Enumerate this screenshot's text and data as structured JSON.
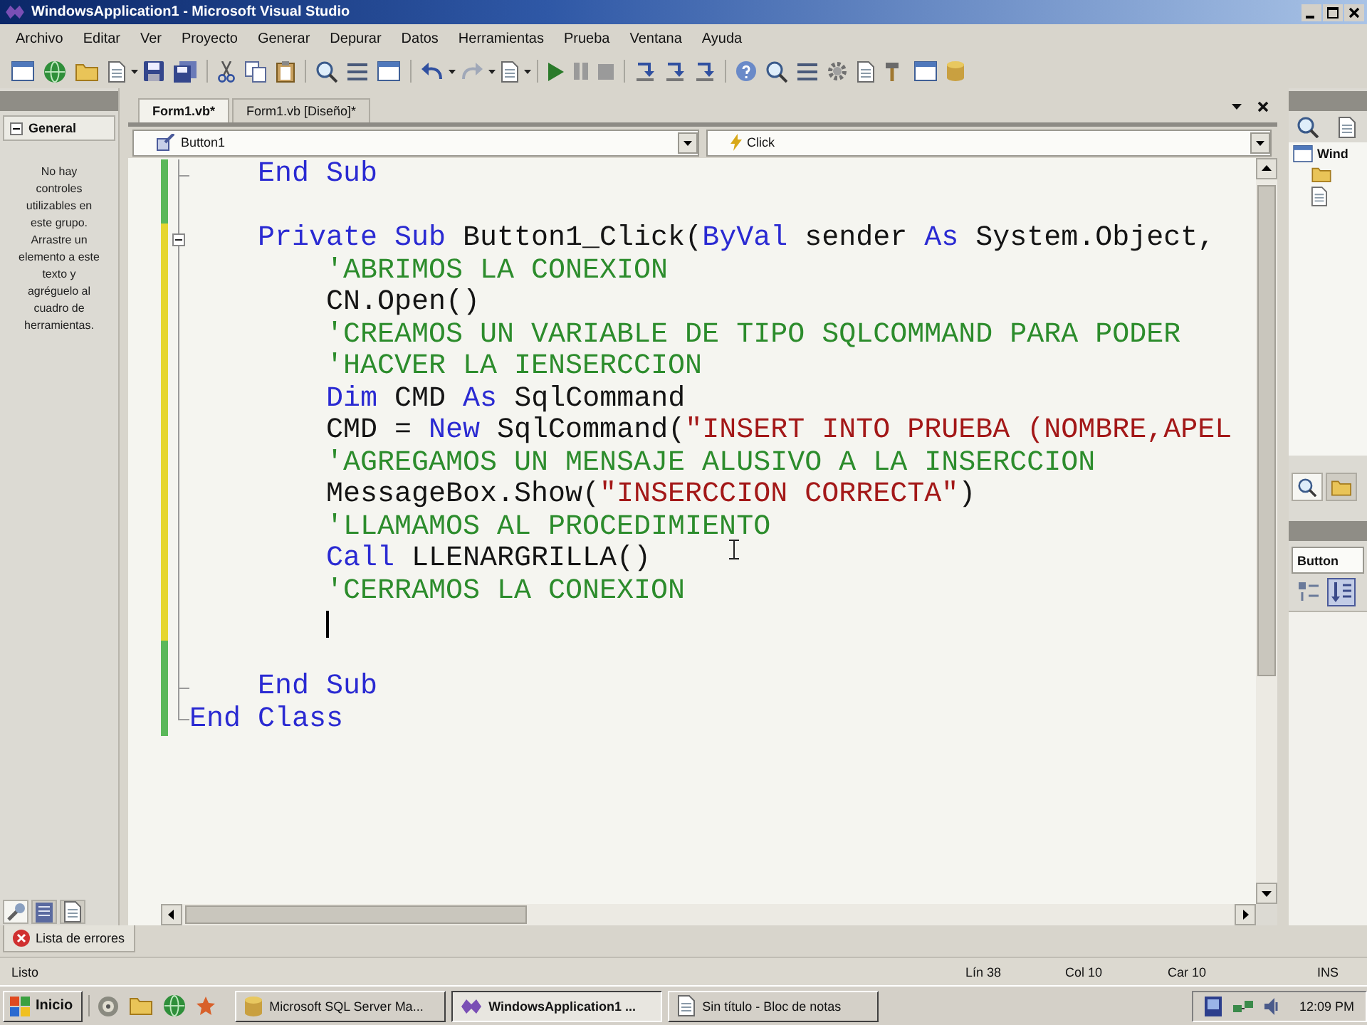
{
  "window": {
    "title": "WindowsApplication1 - Microsoft Visual Studio"
  },
  "menu": [
    "Archivo",
    "Editar",
    "Ver",
    "Proyecto",
    "Generar",
    "Depurar",
    "Datos",
    "Herramientas",
    "Prueba",
    "Ventana",
    "Ayuda"
  ],
  "toolbox": {
    "group": "General",
    "expanded": true,
    "message": "No hay controles utilizables en este grupo. Arrastre un elemento a este texto y agréguelo al cuadro de herramientas."
  },
  "side_tabs": [
    {
      "selected": true
    },
    {
      "selected": false
    },
    {
      "selected": false
    }
  ],
  "doc_tabs": [
    {
      "label": "Form1.vb*",
      "selected": true
    },
    {
      "label": "Form1.vb [Diseño]*",
      "selected": false
    }
  ],
  "editor": {
    "object_combo": "Button1",
    "event_combo": "Click",
    "lines": [
      {
        "kind": "end",
        "saved": true,
        "tokens": [
          {
            "kind": "keyword",
            "text": "    End Sub"
          }
        ]
      },
      {
        "kind": "blank",
        "saved": true
      },
      {
        "kind": "fold",
        "saved": false,
        "tokens": [
          {
            "kind": "keyword",
            "text": "    Private Sub"
          },
          {
            "kind": "plain",
            "text": " Button1_Click("
          },
          {
            "kind": "keyword",
            "text": "ByVal"
          },
          {
            "kind": "plain",
            "text": " sender "
          },
          {
            "kind": "keyword",
            "text": "As"
          },
          {
            "kind": "plain",
            "text": " System.Object,"
          }
        ]
      },
      {
        "kind": "code",
        "saved": false,
        "tokens": [
          {
            "kind": "comment",
            "text": "        'ABRIMOS LA CONEXION"
          }
        ]
      },
      {
        "kind": "code",
        "saved": false,
        "tokens": [
          {
            "kind": "plain",
            "text": "        CN.Open()"
          }
        ]
      },
      {
        "kind": "code",
        "saved": false,
        "tokens": [
          {
            "kind": "comment",
            "text": "        'CREAMOS UN VARIABLE DE TIPO SQLCOMMAND PARA PODER"
          }
        ]
      },
      {
        "kind": "code",
        "saved": false,
        "tokens": [
          {
            "kind": "comment",
            "text": "        'HACVER LA IENSERCCION"
          }
        ]
      },
      {
        "kind": "code",
        "saved": false,
        "tokens": [
          {
            "kind": "keyword",
            "text": "        Dim"
          },
          {
            "kind": "plain",
            "text": " CMD "
          },
          {
            "kind": "keyword",
            "text": "As"
          },
          {
            "kind": "plain",
            "text": " SqlCommand"
          }
        ]
      },
      {
        "kind": "code",
        "saved": false,
        "tokens": [
          {
            "kind": "plain",
            "text": "        CMD = "
          },
          {
            "kind": "keyword",
            "text": "New"
          },
          {
            "kind": "plain",
            "text": " SqlCommand("
          },
          {
            "kind": "string",
            "text": "\"INSERT INTO PRUEBA (NOMBRE,APEL"
          }
        ]
      },
      {
        "kind": "code",
        "saved": false,
        "tokens": [
          {
            "kind": "comment",
            "text": "        'AGREGAMOS UN MENSAJE ALUSIVO A LA INSERCCION"
          }
        ]
      },
      {
        "kind": "code",
        "saved": false,
        "tokens": [
          {
            "kind": "plain",
            "text": "        MessageBox.Show("
          },
          {
            "kind": "string",
            "text": "\"INSERCCION CORRECTA\""
          },
          {
            "kind": "plain",
            "text": ")"
          }
        ]
      },
      {
        "kind": "code",
        "saved": false,
        "tokens": [
          {
            "kind": "comment",
            "text": "        'LLAMAMOS AL PROCEDIMIENTO"
          }
        ]
      },
      {
        "kind": "code",
        "saved": false,
        "tokens": [
          {
            "kind": "keyword",
            "text": "        Call"
          },
          {
            "kind": "plain",
            "text": " LLENARGRILLA()"
          }
        ]
      },
      {
        "kind": "code",
        "saved": false,
        "tokens": [
          {
            "kind": "comment",
            "text": "        'CERRAMOS LA CONEXION"
          }
        ]
      },
      {
        "kind": "caret",
        "saved": false
      },
      {
        "kind": "blank",
        "saved": true
      },
      {
        "kind": "end",
        "saved": true,
        "tokens": [
          {
            "kind": "keyword",
            "text": "    End Sub"
          }
        ]
      },
      {
        "kind": "end",
        "saved": true,
        "tokens": [
          {
            "kind": "keyword",
            "text": "End Class"
          }
        ]
      }
    ]
  },
  "solution_explorer": {
    "items": [
      {
        "label": "Wind"
      }
    ],
    "tabs": [
      {
        "selected": true
      },
      {
        "selected": false
      }
    ]
  },
  "properties": {
    "object": "Button",
    "views": [
      {
        "selected": false
      },
      {
        "selected": true
      }
    ]
  },
  "error_list_tab": "Lista de errores",
  "status_bar": {
    "message": "Listo",
    "line": "Lín 38",
    "col": "Col 10",
    "char": "Car 10",
    "mode": "INS"
  },
  "taskbar": {
    "start": "Inicio",
    "tasks": [
      {
        "label": "Microsoft SQL Server Ma...",
        "selected": false
      },
      {
        "label": "WindowsApplication1 ...",
        "selected": true
      },
      {
        "label": "Sin título - Bloc de notas",
        "selected": false
      }
    ],
    "clock": "12:09 PM"
  }
}
